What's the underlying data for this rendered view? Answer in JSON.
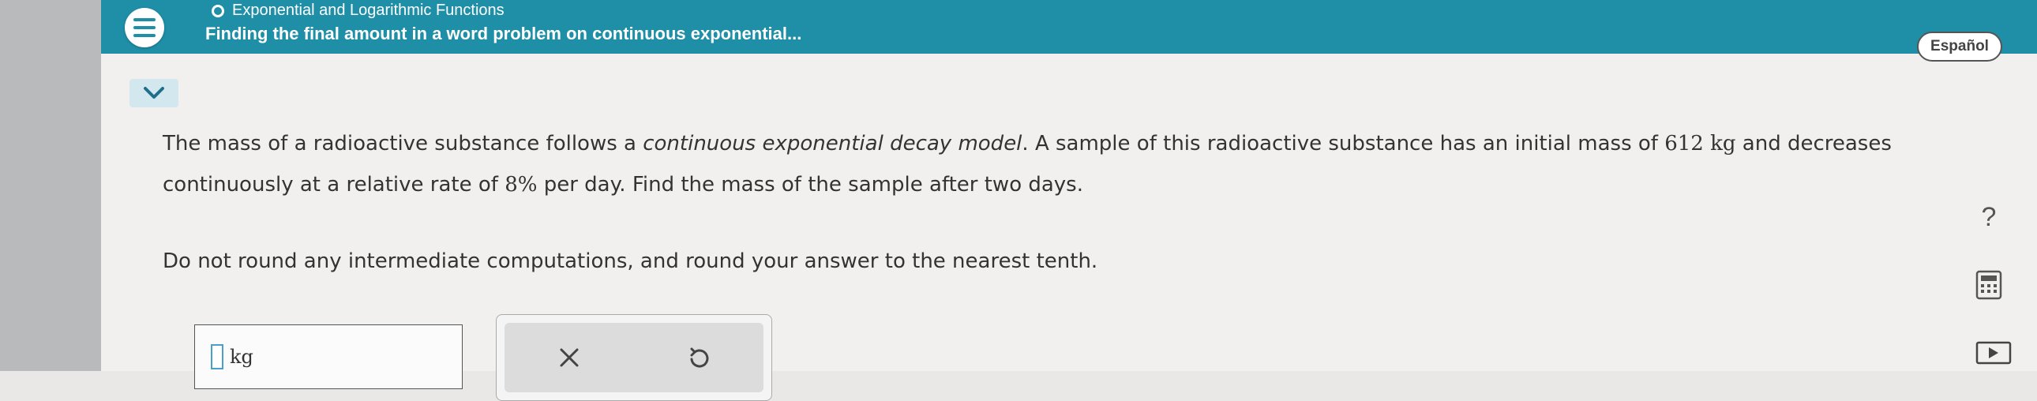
{
  "header": {
    "topic": "Exponential and Logarithmic Functions",
    "problem_title": "Finding the final amount in a word problem on continuous exponential...",
    "language_button": "Español"
  },
  "question": {
    "p1": "The mass of a radioactive substance follows a",
    "p1_emph": "continuous exponential decay model",
    "p2": ". A sample of this radioactive substance has an initial mass of",
    "initial_mass": "612 kg",
    "p3": "and decreases continuously at a relative rate of",
    "rate": "8%",
    "p4": "per day. Find the mass of the sample after two days.",
    "note": "Do not round any intermediate computations, and round your answer to the nearest tenth."
  },
  "answer": {
    "value": "",
    "unit": "kg"
  },
  "tools": {
    "clear_icon": "close-icon",
    "undo_icon": "undo-icon"
  },
  "right_rail": {
    "help_label": "?",
    "calculator_icon": "calculator-icon",
    "play_icon": "play-icon"
  },
  "colors": {
    "header_bg": "#1f8fa8",
    "accent": "#4aa0c8"
  }
}
